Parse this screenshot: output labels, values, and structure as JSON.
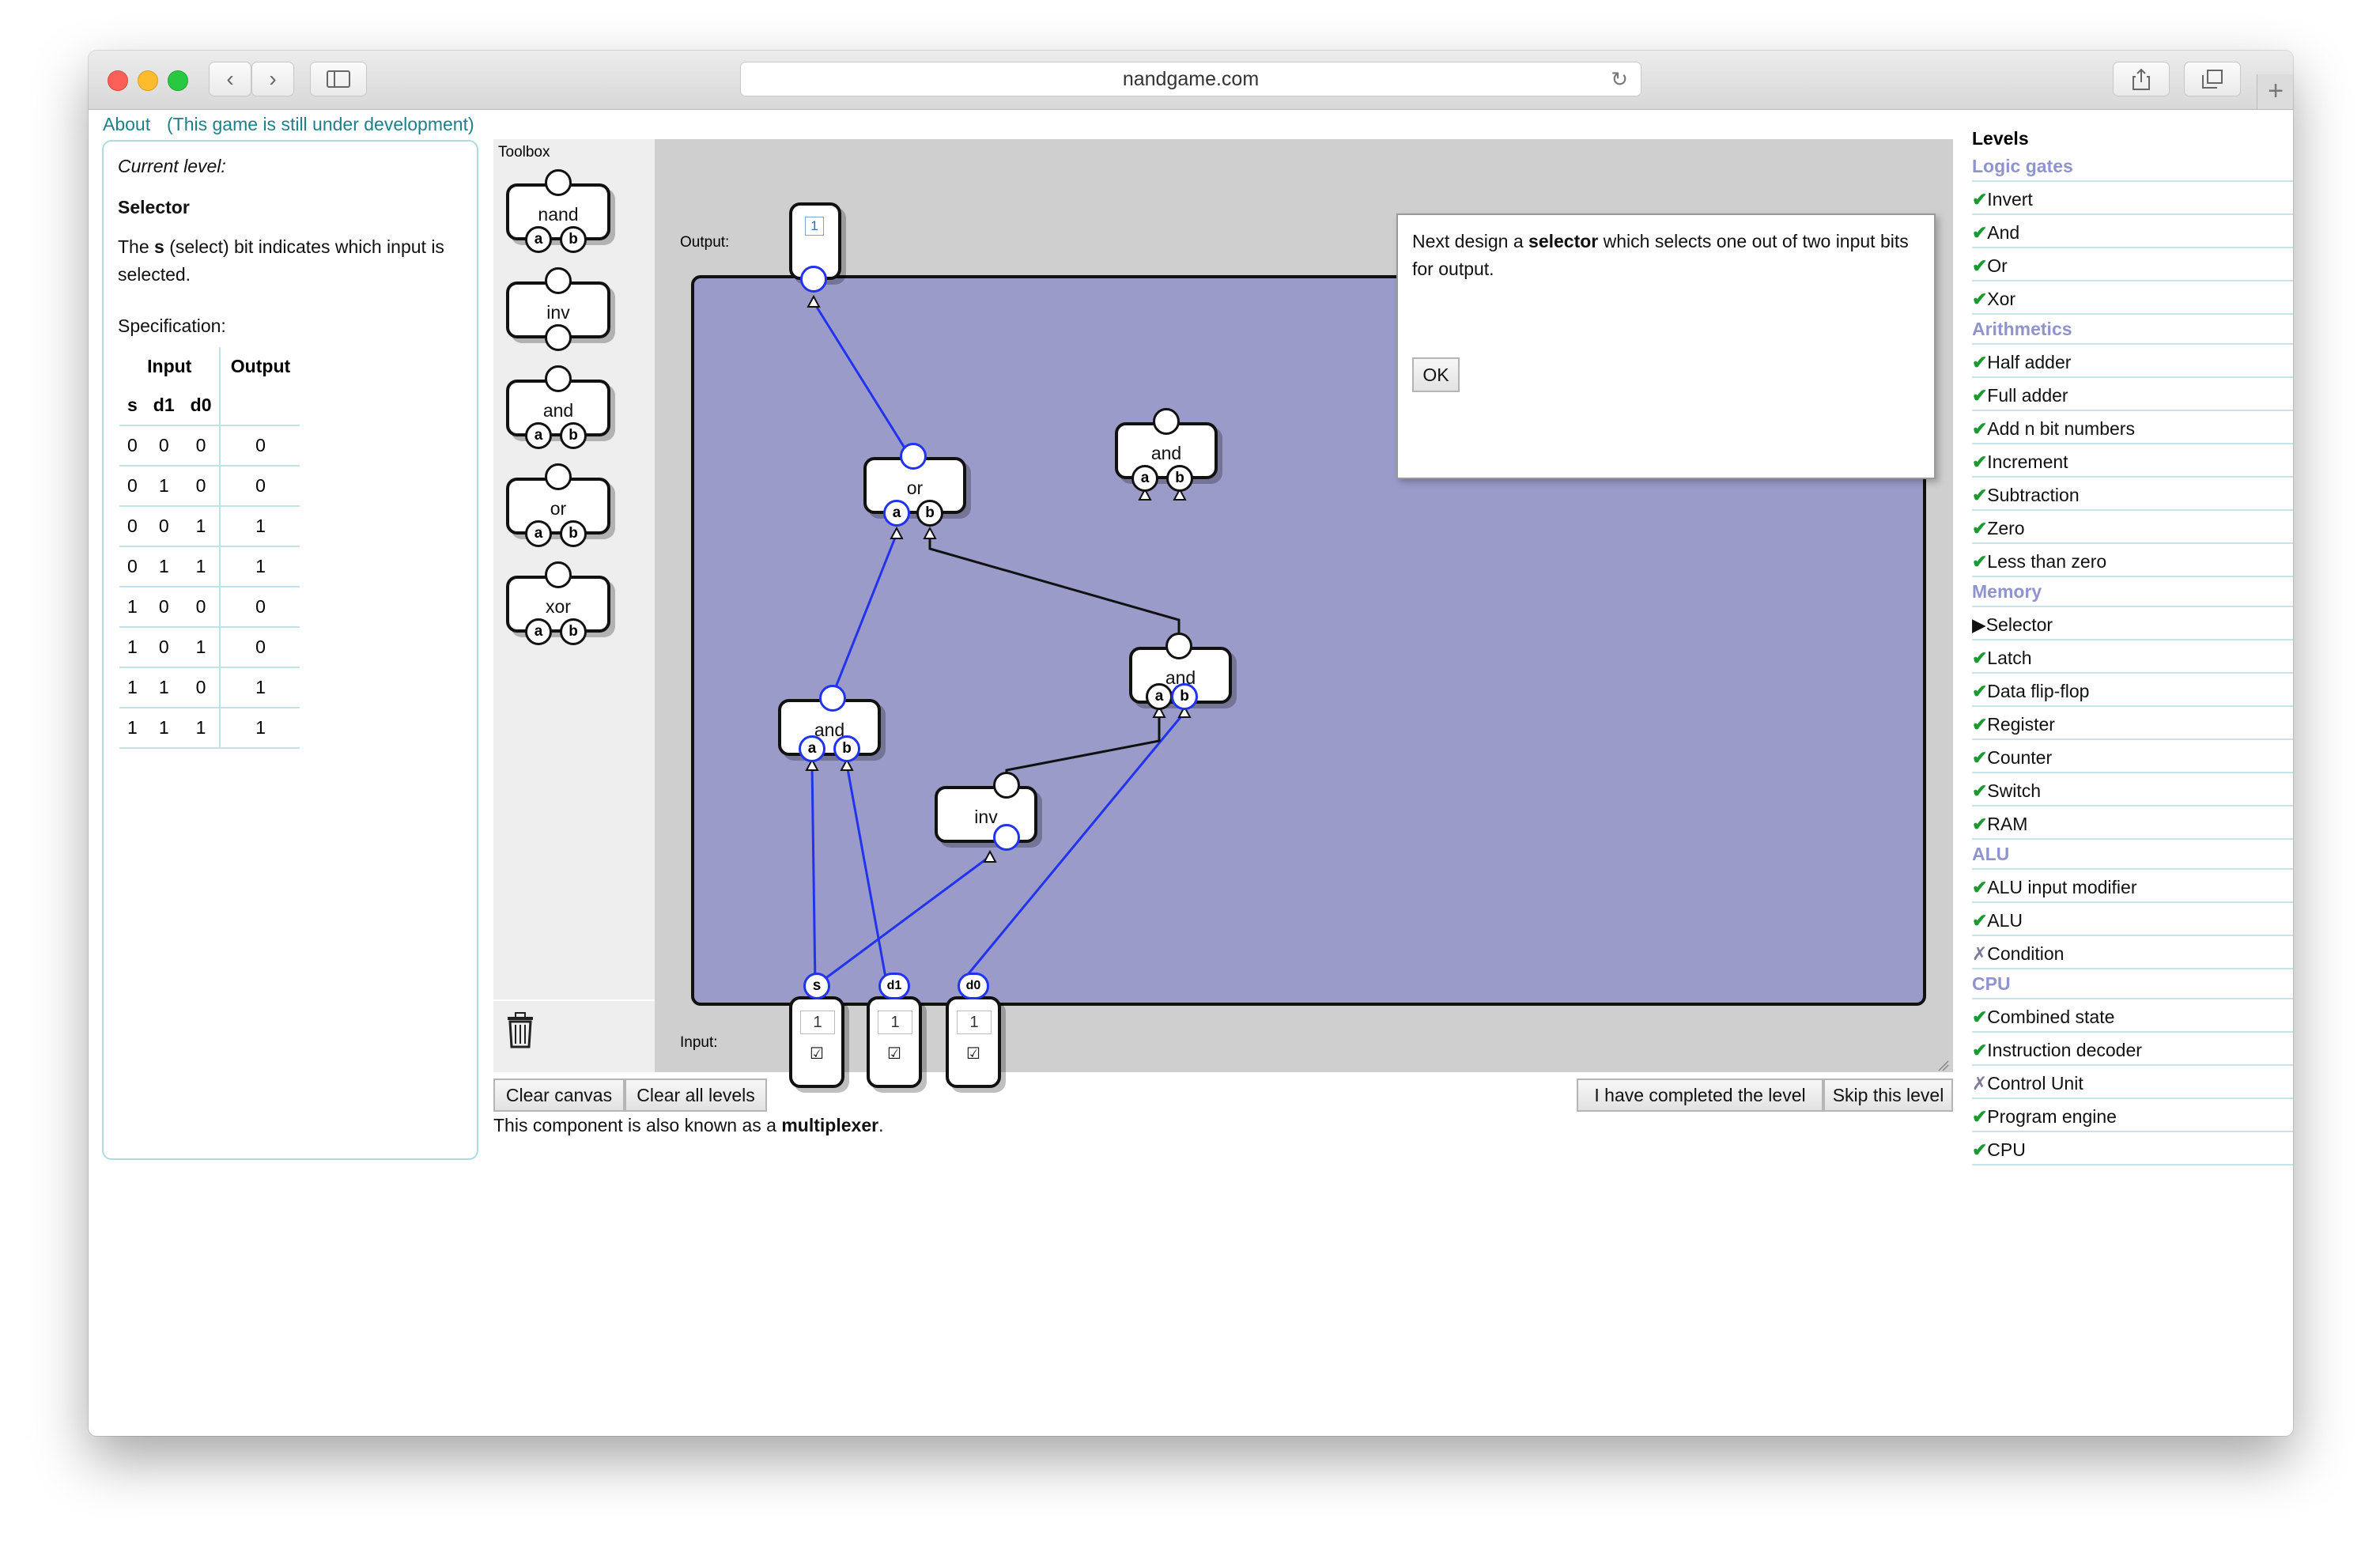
{
  "browser": {
    "url": "nandgame.com"
  },
  "topbar": {
    "about": "About",
    "dev_note": "(This game is still under development)"
  },
  "left": {
    "current_level_label": "Current level:",
    "level_name": "Selector",
    "desc_prefix": "The ",
    "desc_bold": "s",
    "desc_suffix": " (select) bit indicates which input is selected.",
    "spec_label": "Specification:",
    "table": {
      "input_header": "Input",
      "output_header": "Output",
      "columns": [
        "s",
        "d1",
        "d0"
      ],
      "rows": [
        [
          "0",
          "0",
          "0",
          "0"
        ],
        [
          "0",
          "1",
          "0",
          "0"
        ],
        [
          "0",
          "0",
          "1",
          "1"
        ],
        [
          "0",
          "1",
          "1",
          "1"
        ],
        [
          "1",
          "0",
          "0",
          "0"
        ],
        [
          "1",
          "0",
          "1",
          "0"
        ],
        [
          "1",
          "1",
          "0",
          "1"
        ],
        [
          "1",
          "1",
          "1",
          "1"
        ]
      ]
    }
  },
  "toolbox": {
    "title": "Toolbox",
    "items": [
      "nand",
      "inv",
      "and",
      "or",
      "xor"
    ]
  },
  "canvas": {
    "output_label": "Output:",
    "input_label": "Input:",
    "output_value": "1",
    "components": {
      "or_gate": "or",
      "and_top": "and",
      "and_right": "and",
      "and_left": "and",
      "inv_gate": "inv"
    },
    "pin_a": "a",
    "pin_b": "b",
    "inputs": [
      {
        "name": "s",
        "value": "1",
        "checked": "☑"
      },
      {
        "name": "d1",
        "value": "1",
        "checked": "☑"
      },
      {
        "name": "d0",
        "value": "1",
        "checked": "☑"
      }
    ]
  },
  "dialog": {
    "text_prefix": "Next design a ",
    "text_bold": "selector",
    "text_suffix": " which selects one out of two input bits for output.",
    "ok": "OK"
  },
  "bottom": {
    "clear_canvas": "Clear canvas",
    "clear_all_levels": "Clear all levels",
    "completed": "I have completed the level",
    "skip": "Skip this level",
    "note_prefix": "This component is also known as a ",
    "note_bold": "multiplexer",
    "note_suffix": "."
  },
  "levels": {
    "title": "Levels",
    "groups": [
      {
        "name": "Logic gates",
        "items": [
          {
            "mark": "✔",
            "label": "Invert"
          },
          {
            "mark": "✔",
            "label": "And"
          },
          {
            "mark": "✔",
            "label": "Or"
          },
          {
            "mark": "✔",
            "label": "Xor"
          }
        ]
      },
      {
        "name": "Arithmetics",
        "items": [
          {
            "mark": "✔",
            "label": "Half adder"
          },
          {
            "mark": "✔",
            "label": "Full adder"
          },
          {
            "mark": "✔",
            "label": "Add n bit numbers"
          },
          {
            "mark": "✔",
            "label": "Increment"
          },
          {
            "mark": "✔",
            "label": "Subtraction"
          },
          {
            "mark": "✔",
            "label": "Zero"
          },
          {
            "mark": "✔",
            "label": "Less than zero"
          }
        ]
      },
      {
        "name": "Memory",
        "items": [
          {
            "mark": "▶",
            "label": "Selector"
          },
          {
            "mark": "✔",
            "label": "Latch"
          },
          {
            "mark": "✔",
            "label": "Data flip-flop"
          },
          {
            "mark": "✔",
            "label": "Register"
          },
          {
            "mark": "✔",
            "label": "Counter"
          },
          {
            "mark": "✔",
            "label": "Switch"
          },
          {
            "mark": "✔",
            "label": "RAM"
          }
        ]
      },
      {
        "name": "ALU",
        "items": [
          {
            "mark": "✔",
            "label": "ALU input modifier"
          },
          {
            "mark": "✔",
            "label": "ALU"
          },
          {
            "mark": "✗",
            "label": "Condition"
          }
        ]
      },
      {
        "name": "CPU",
        "items": [
          {
            "mark": "✔",
            "label": "Combined state"
          },
          {
            "mark": "✔",
            "label": "Instruction decoder"
          },
          {
            "mark": "✗",
            "label": "Control Unit"
          },
          {
            "mark": "✔",
            "label": "Program engine"
          },
          {
            "mark": "✔",
            "label": "CPU"
          }
        ]
      }
    ]
  },
  "colors": {
    "board": "#9b9bc9",
    "wire_active": "#2233ee",
    "wire_inactive": "#111111",
    "check": "#1a9a30",
    "category": "#8f94cf",
    "link": "#1e7f8a"
  }
}
